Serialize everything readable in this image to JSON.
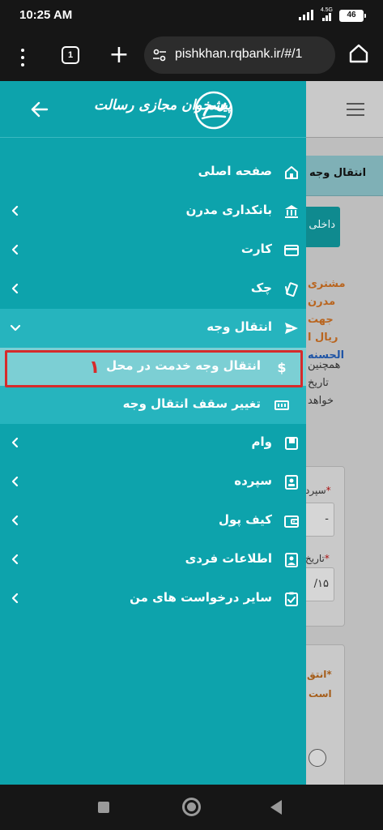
{
  "status_bar": {
    "time": "10:25 AM",
    "network": "4.5G",
    "battery": "46"
  },
  "browser": {
    "tab_count": "1",
    "url": "pishkhan.rqbank.ir/#/1"
  },
  "drawer": {
    "logo_text": "پیشخوان مجازی رسالت",
    "menu_items": [
      {
        "label": "صفحه اصلی",
        "icon": "home-icon",
        "has_chevron": false
      },
      {
        "label": "بانکداری مدرن",
        "icon": "bank-icon",
        "has_chevron": true
      },
      {
        "label": "کارت",
        "icon": "card-icon",
        "has_chevron": true
      },
      {
        "label": "چک",
        "icon": "cheque-icon",
        "has_chevron": true
      },
      {
        "label": "انتقال وجه",
        "icon": "send-icon",
        "has_chevron": true,
        "expanded": true
      }
    ],
    "submenu_items": [
      {
        "label": "انتقال وجه خدمت در محل",
        "icon": "dollar-icon",
        "active": true
      },
      {
        "label": "تغییر سقف انتقال وجه",
        "icon": "limit-icon",
        "active": false
      }
    ],
    "menu_items_after": [
      {
        "label": "وام",
        "icon": "loan-icon"
      },
      {
        "label": "سپرده",
        "icon": "deposit-icon"
      },
      {
        "label": "کیف پول",
        "icon": "wallet-icon"
      },
      {
        "label": "اطلاعات فردی",
        "icon": "profile-icon"
      },
      {
        "label": "سایر درخواست های من",
        "icon": "requests-icon"
      }
    ],
    "annotation_number": "۱"
  },
  "page": {
    "title": "انتقال وجه",
    "enter_button": "داخلی",
    "warning_lines": [
      "مشتری",
      "مدرن",
      "جهت",
      "ریال ا"
    ],
    "warning_link": "الحسنه",
    "info_lines": [
      "همچنین",
      "تاریخ",
      "خواهد"
    ],
    "field1_label": "سپرد",
    "field1_value": "-",
    "field2_label": "تاریخ",
    "field2_value": "/۱۵",
    "question_lines": [
      "*انتق",
      "است"
    ]
  },
  "colors": {
    "drawer_bg": "#0da3ac",
    "expanded_bg": "#26b4be",
    "active_bg": "#7ccfd4",
    "annotation": "#d62b2b"
  }
}
